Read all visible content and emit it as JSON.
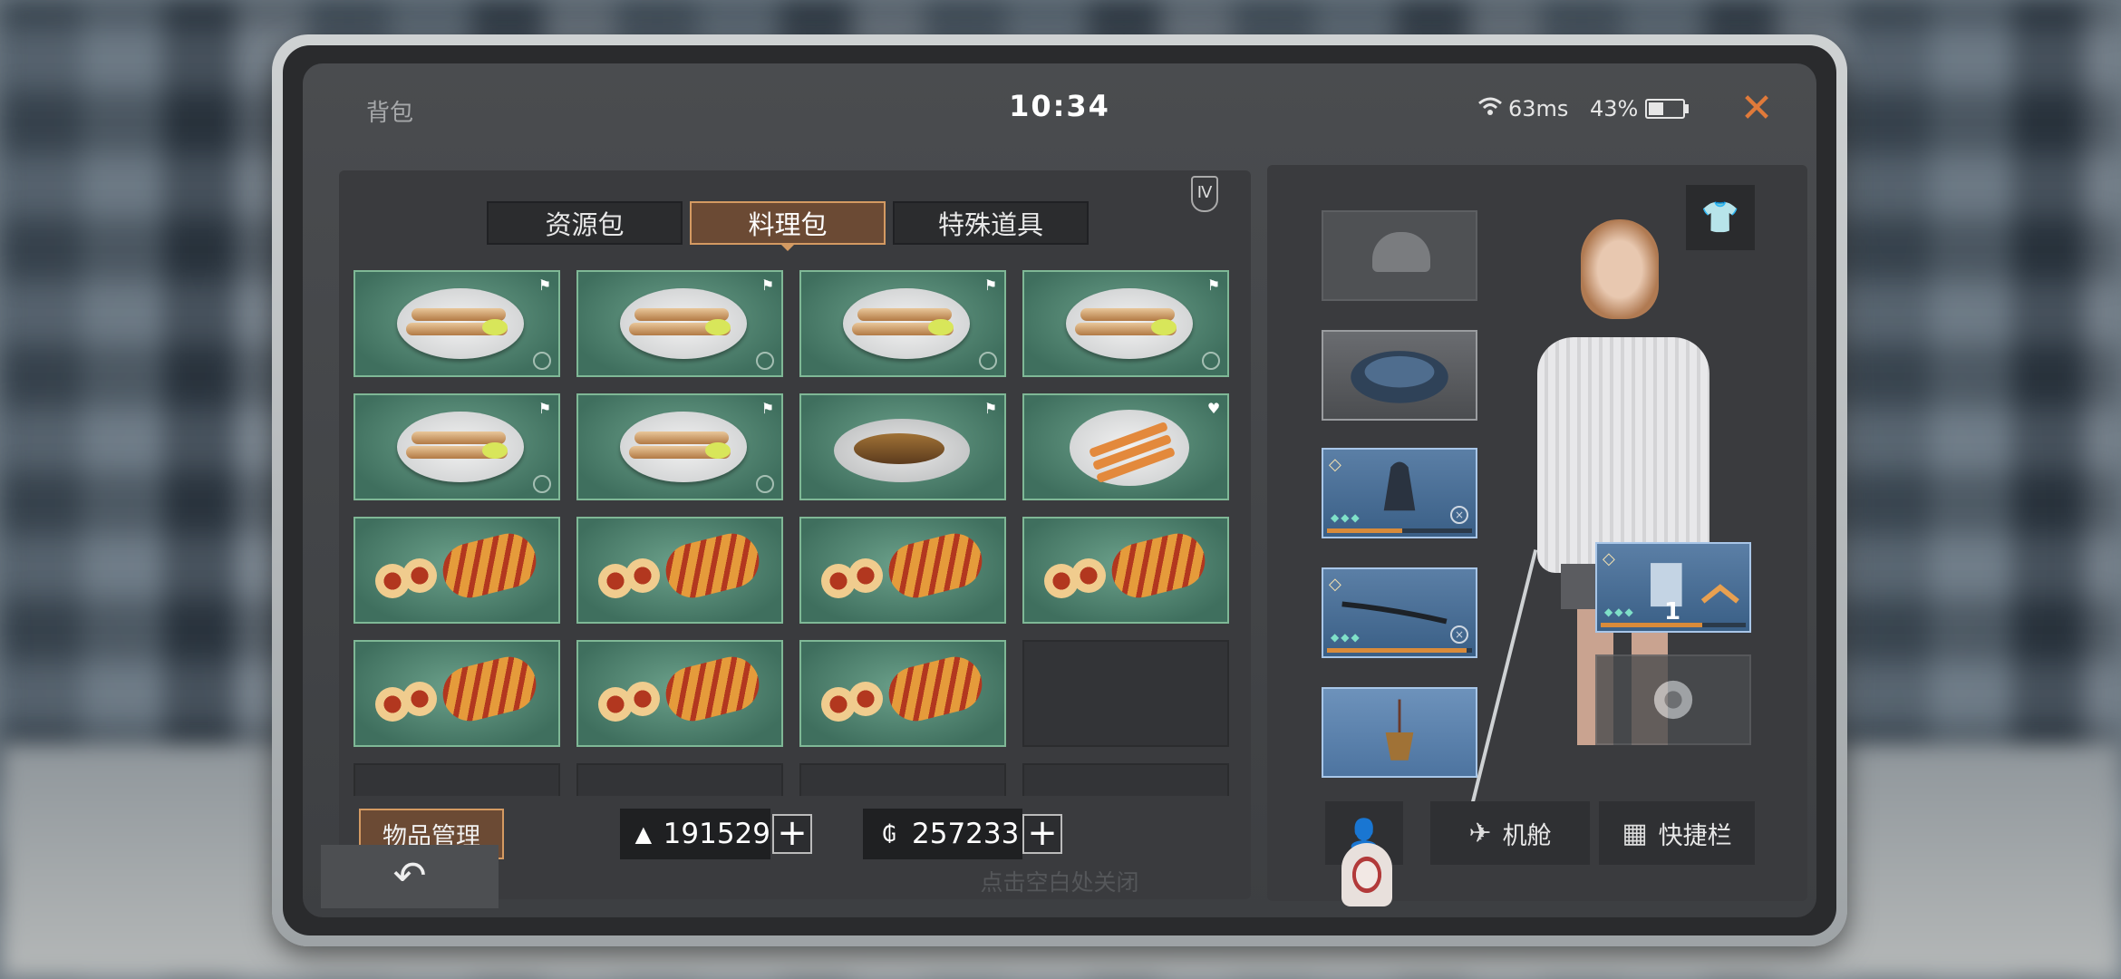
{
  "header": {
    "title": "背包",
    "clock": "10:34",
    "ping": "63ms",
    "battery_percent": "43%",
    "battery_level": 0.43,
    "close_icon": "close-icon"
  },
  "tier_badge": "Ⅳ",
  "tabs": [
    {
      "label": "资源包",
      "active": false
    },
    {
      "label": "料理包",
      "active": true
    },
    {
      "label": "特殊道具",
      "active": false
    }
  ],
  "inventory": {
    "items": [
      {
        "kind": "fish-plate",
        "corner": "flag-icon"
      },
      {
        "kind": "fish-plate",
        "corner": "flag-icon"
      },
      {
        "kind": "fish-plate",
        "corner": "flag-icon"
      },
      {
        "kind": "fish-plate",
        "corner": "flag-icon"
      },
      {
        "kind": "fish-plate",
        "corner": "flag-icon"
      },
      {
        "kind": "fish-plate",
        "corner": "flag-icon"
      },
      {
        "kind": "grilled-fish",
        "corner": "flag-icon"
      },
      {
        "kind": "skewer-plate",
        "corner": "heart-icon"
      },
      {
        "kind": "sausage-roll"
      },
      {
        "kind": "sausage-roll"
      },
      {
        "kind": "sausage-roll"
      },
      {
        "kind": "sausage-roll"
      },
      {
        "kind": "sausage-roll"
      },
      {
        "kind": "sausage-roll"
      },
      {
        "kind": "sausage-roll"
      },
      {
        "kind": "empty"
      },
      {
        "kind": "empty"
      },
      {
        "kind": "empty"
      },
      {
        "kind": "empty"
      },
      {
        "kind": "empty"
      }
    ]
  },
  "manage_button": "物品管理",
  "currency": {
    "gold": "191529",
    "coins": "257233",
    "gold_icon": "gold-bar-icon",
    "coin_icon": "coin-g-icon"
  },
  "equipment": {
    "slots": [
      "helmet",
      "backpack",
      "outfit",
      "weapon",
      "accessory"
    ],
    "featured_count": "1"
  },
  "buttons": {
    "profile": "profile-icon",
    "cabin": "机舱",
    "quickbar": "快捷栏"
  },
  "bottom": {
    "back_icon": "back-arrow-icon",
    "hint": "点击空白处关闭"
  }
}
